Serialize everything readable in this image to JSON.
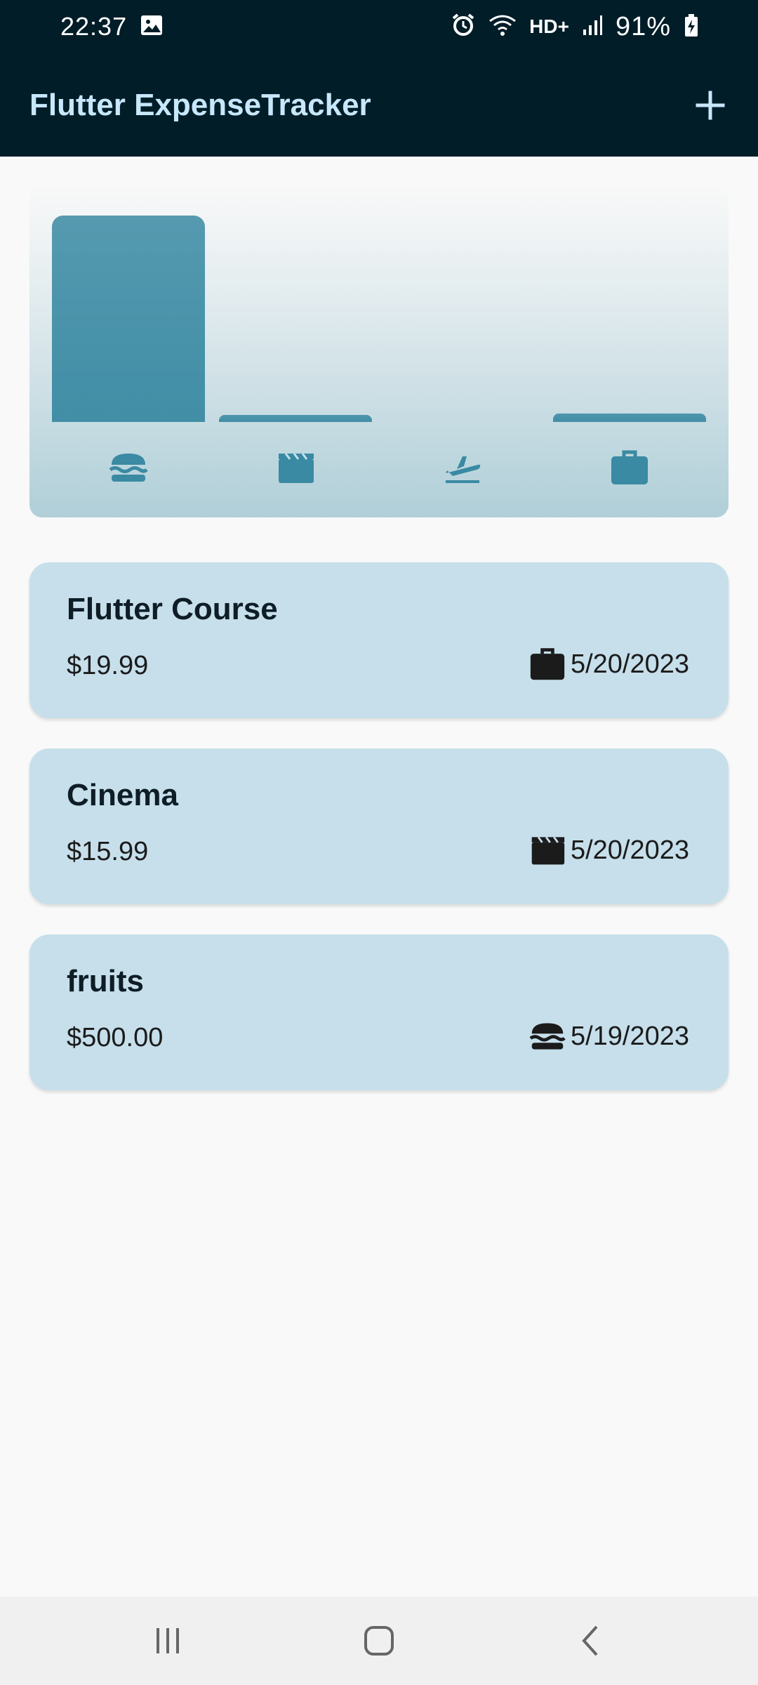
{
  "status_bar": {
    "time": "22:37",
    "network_label": "HD+",
    "battery_percent": "91%"
  },
  "app_bar": {
    "title": "Flutter ExpenseTracker",
    "add_icon": "plus-icon"
  },
  "chart_data": {
    "type": "bar",
    "categories": [
      "food",
      "leisure",
      "travel",
      "work"
    ],
    "category_icons": [
      "burger-icon",
      "clapperboard-icon",
      "flight-takeoff-icon",
      "briefcase-icon"
    ],
    "values": [
      500.0,
      15.99,
      0,
      19.99
    ],
    "ylim": [
      0,
      500.0
    ],
    "color": "#3a8aa3"
  },
  "expenses": [
    {
      "title": "Flutter Course",
      "amount": "$19.99",
      "date": "5/20/2023",
      "category_icon": "briefcase-icon"
    },
    {
      "title": "Cinema",
      "amount": "$15.99",
      "date": "5/20/2023",
      "category_icon": "clapperboard-icon"
    },
    {
      "title": "fruits",
      "amount": "$500.00",
      "date": "5/19/2023",
      "category_icon": "burger-icon"
    }
  ],
  "nav_bar": {
    "buttons": [
      "recent-apps-icon",
      "home-icon",
      "back-icon"
    ]
  },
  "colors": {
    "app_bar_bg": "#001d28",
    "title_color": "#c7e7fb",
    "card_bg": "#c6dfeb",
    "accent": "#3a8aa3"
  }
}
